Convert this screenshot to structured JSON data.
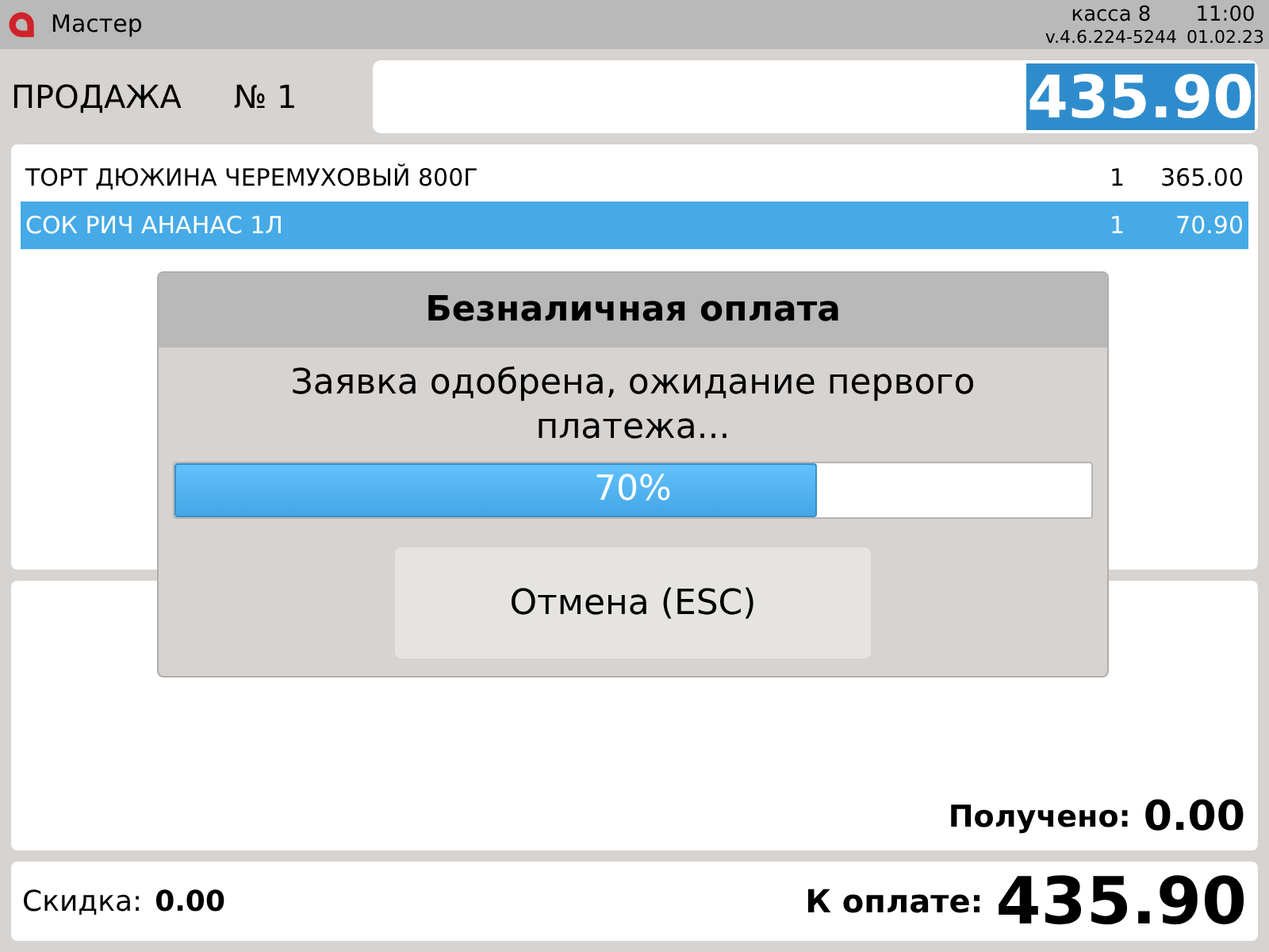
{
  "header": {
    "app_title": "Мастер",
    "register": "касса 8",
    "time": "11:00",
    "version": "v.4.6.224-5244",
    "date": "01.02.23"
  },
  "sale": {
    "label": "ПРОДАЖА",
    "number": "№ 1",
    "total": "435.90"
  },
  "items": [
    {
      "name": "ТОРТ ДЮЖИНА ЧЕРЕМУХОВЫЙ 800Г",
      "quantity": "1",
      "price": "365.00",
      "selected": false
    },
    {
      "name": "СОК РИЧ АНАНАС 1Л",
      "quantity": "1",
      "price": "70.90",
      "selected": true
    }
  ],
  "payment": {
    "received_label": "Получено:",
    "received": "0.00",
    "discount_label": "Скидка:",
    "discount": "0.00",
    "due_label": "К оплате:",
    "due": "435.90"
  },
  "dialog": {
    "title": "Безналичная оплата",
    "message": "Заявка одобрена, ожидание первого платежа...",
    "progress": {
      "level": 0.7,
      "reading": "70%"
    },
    "buttons": [
      "Отмена (ESC)"
    ]
  }
}
